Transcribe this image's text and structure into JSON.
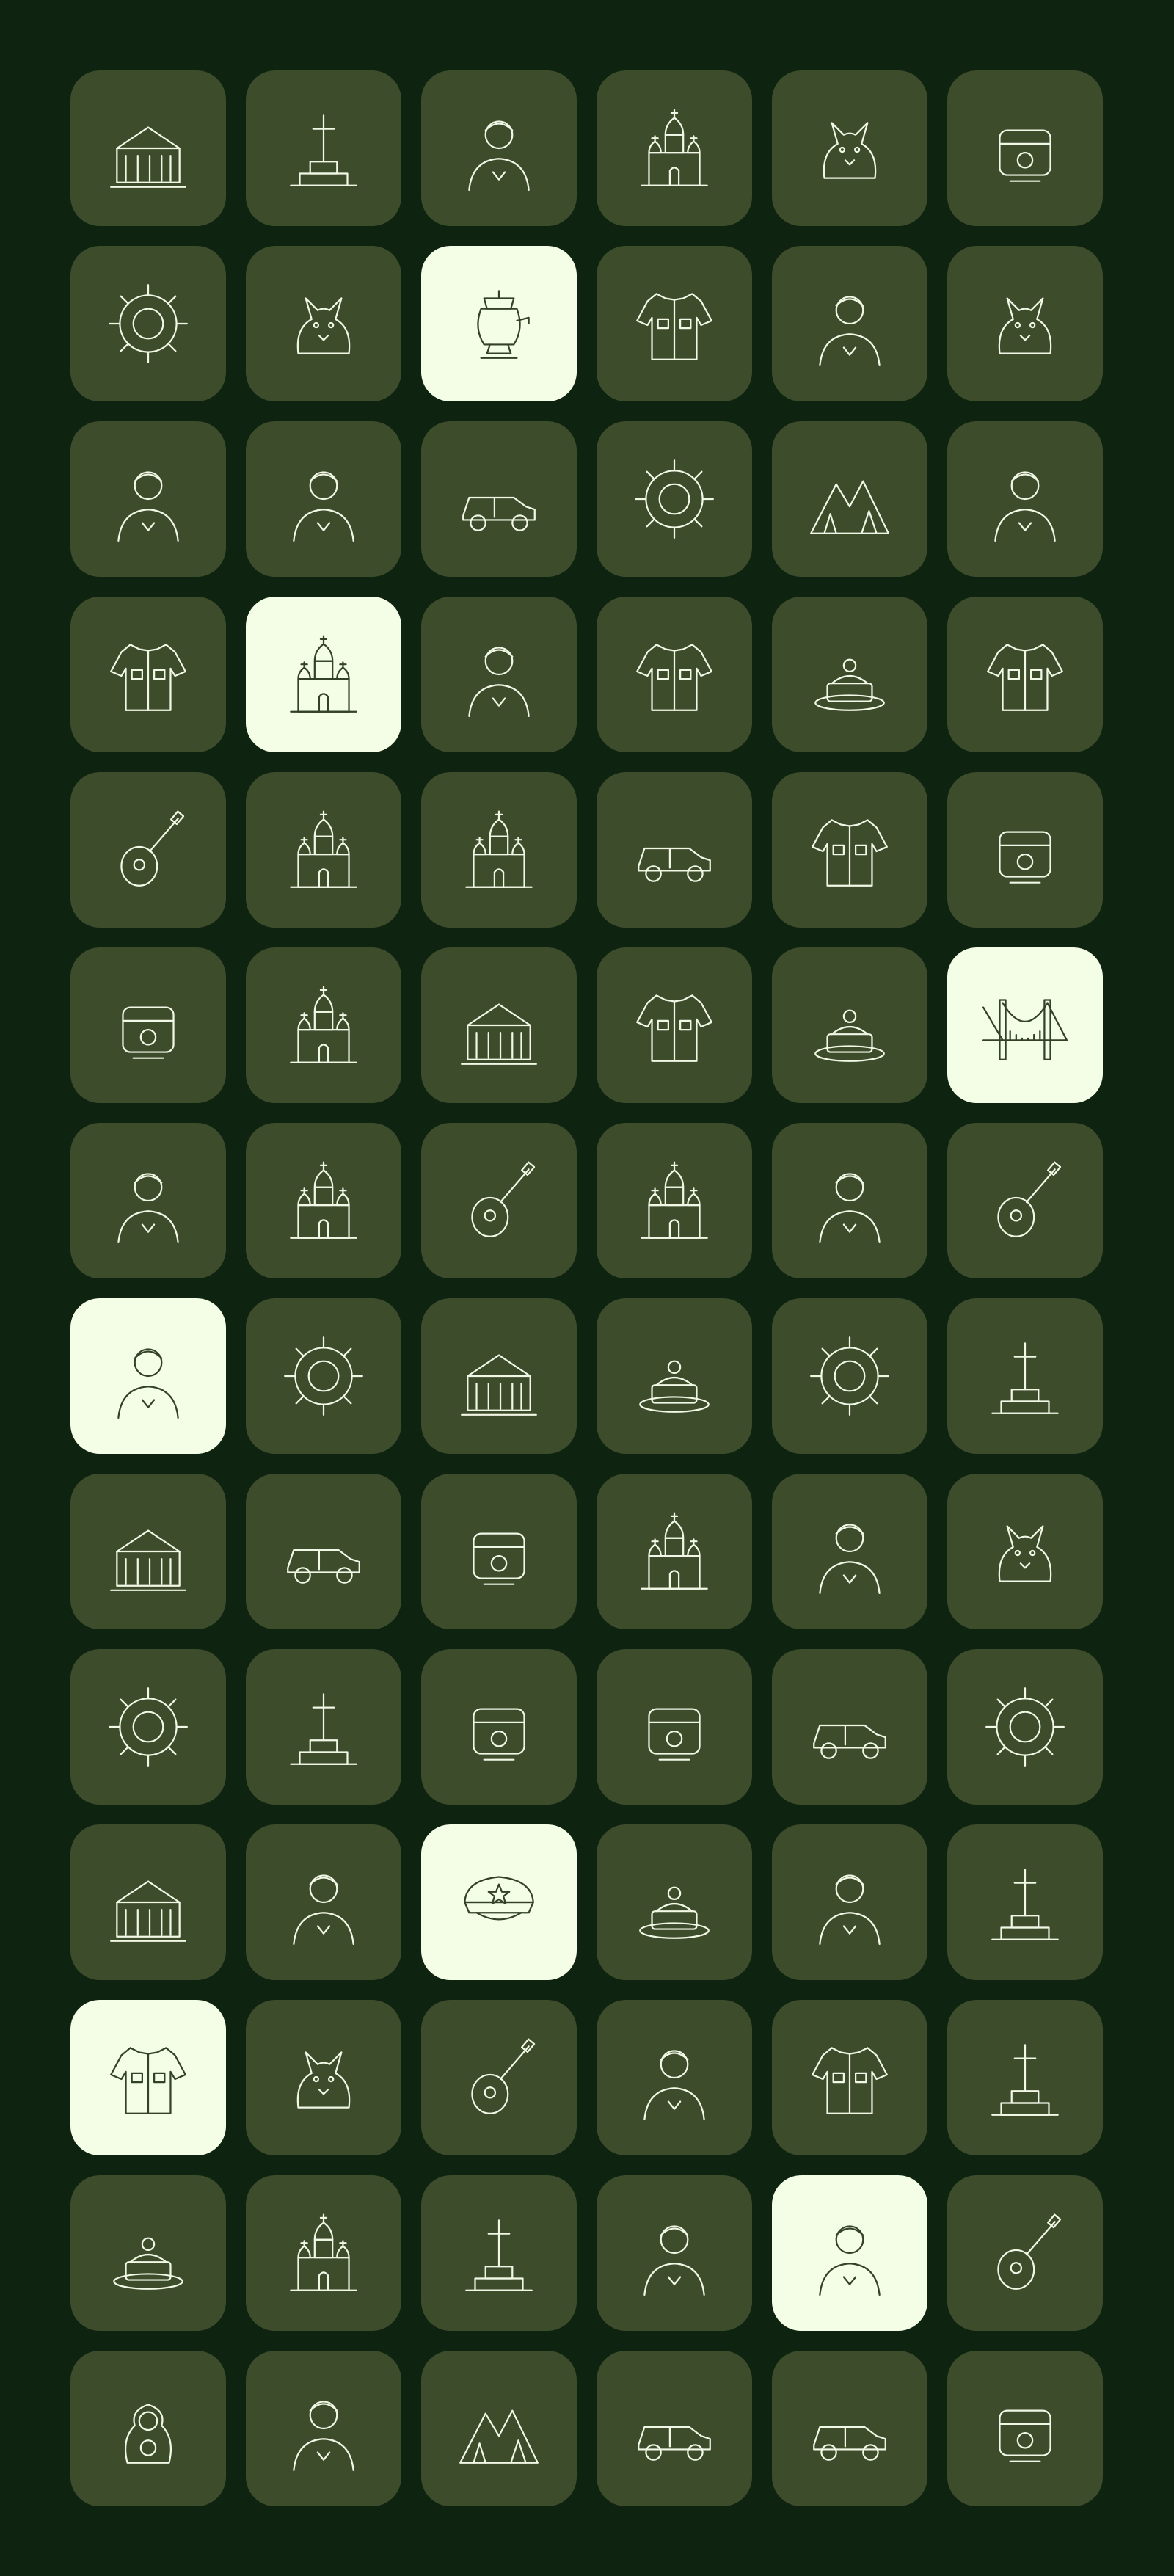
{
  "palette": {
    "background": "#0f2311",
    "tile": "#3d4c2b",
    "tile_selected": "#f4fde6",
    "icon_stroke": "#f2f8e6",
    "icon_stroke_selected": "#33402a"
  },
  "icons": [
    {
      "name": "mausoleum-icon",
      "selected": false
    },
    {
      "name": "crystals-monument-icon",
      "selected": false
    },
    {
      "name": "hockey-player-icon",
      "selected": false
    },
    {
      "name": "kremlin-cathedral-icon",
      "selected": false
    },
    {
      "name": "deer-head-icon",
      "selected": false
    },
    {
      "name": "pickles-jar-icon",
      "selected": false
    },
    {
      "name": "hammer-sickle-shield-icon",
      "selected": false
    },
    {
      "name": "horse-rider-icon",
      "selected": false
    },
    {
      "name": "samovar-icon",
      "selected": true
    },
    {
      "name": "folk-dress-icon",
      "selected": false
    },
    {
      "name": "bearded-man-icon",
      "selected": false
    },
    {
      "name": "cat-icon",
      "selected": false
    },
    {
      "name": "ballerina-icon",
      "selected": false
    },
    {
      "name": "soldier-portrait-icon",
      "selected": false
    },
    {
      "name": "steam-locomotive-icon",
      "selected": false
    },
    {
      "name": "sun-ornament-icon",
      "selected": false
    },
    {
      "name": "mountains-forest-icon",
      "selected": false
    },
    {
      "name": "orthodox-priest-icon",
      "selected": false
    },
    {
      "name": "jacket-icon",
      "selected": false
    },
    {
      "name": "church-icon",
      "selected": true
    },
    {
      "name": "woman-fur-coat-icon",
      "selected": false
    },
    {
      "name": "military-shirt-icon",
      "selected": false
    },
    {
      "name": "tea-set-icon",
      "selected": false
    },
    {
      "name": "folk-skirt-icon",
      "selected": false
    },
    {
      "name": "bagpipes-icon",
      "selected": false
    },
    {
      "name": "postage-stamp-icon",
      "selected": false
    },
    {
      "name": "palace-icon",
      "selected": false
    },
    {
      "name": "viking-ship-icon",
      "selected": false
    },
    {
      "name": "shawl-icon",
      "selected": false
    },
    {
      "name": "chess-board-icon",
      "selected": false
    },
    {
      "name": "chalice-icon",
      "selected": false
    },
    {
      "name": "tourists-kremlin-icon",
      "selected": false
    },
    {
      "name": "theatre-building-icon",
      "selected": false
    },
    {
      "name": "embroidered-shirt-icon",
      "selected": false
    },
    {
      "name": "layered-cake-icon",
      "selected": false
    },
    {
      "name": "bridge-icon",
      "selected": true
    },
    {
      "name": "man-cap-icon",
      "selected": false
    },
    {
      "name": "onion-dome-cathedral-icon",
      "selected": false
    },
    {
      "name": "maracas-icon",
      "selected": false
    },
    {
      "name": "monastery-icon",
      "selected": false
    },
    {
      "name": "cosmonaut-icon",
      "selected": false
    },
    {
      "name": "saxophone-icon",
      "selected": false
    },
    {
      "name": "children-reading-icon",
      "selected": true
    },
    {
      "name": "star-medal-icon",
      "selected": false
    },
    {
      "name": "triumphal-arch-icon",
      "selected": false
    },
    {
      "name": "honey-pancakes-icon",
      "selected": false
    },
    {
      "name": "flower-brush-icon",
      "selected": false
    },
    {
      "name": "drawbridge-icon",
      "selected": false
    },
    {
      "name": "government-building-icon",
      "selected": false
    },
    {
      "name": "vintage-car-icon",
      "selected": false
    },
    {
      "name": "street-cart-icon",
      "selected": false
    },
    {
      "name": "basilica-icon",
      "selected": false
    },
    {
      "name": "nun-icon",
      "selected": false
    },
    {
      "name": "rooster-icon",
      "selected": false
    },
    {
      "name": "folk-flower-ornament-icon",
      "selected": false
    },
    {
      "name": "spasskaya-tower-icon",
      "selected": false
    },
    {
      "name": "beer-tap-mug-icon",
      "selected": false
    },
    {
      "name": "stove-icon",
      "selected": false
    },
    {
      "name": "cannon-icon",
      "selected": false
    },
    {
      "name": "spinning-wheel-icon",
      "selected": false
    },
    {
      "name": "university-tower-icon",
      "selected": false
    },
    {
      "name": "woman-kokoshnik-icon",
      "selected": false
    },
    {
      "name": "peaked-cap-icon",
      "selected": true
    },
    {
      "name": "bagels-icon",
      "selected": false
    },
    {
      "name": "man-hat-icon",
      "selected": false
    },
    {
      "name": "statue-icon",
      "selected": false
    },
    {
      "name": "military-coat-icon",
      "selected": true
    },
    {
      "name": "fox-snow-icon",
      "selected": false
    },
    {
      "name": "balalaika-icon",
      "selected": false
    },
    {
      "name": "guitar-player-icon",
      "selected": false
    },
    {
      "name": "patterned-scarf-icon",
      "selected": false
    },
    {
      "name": "cross-monument-icon",
      "selected": false
    },
    {
      "name": "festive-table-icon",
      "selected": false
    },
    {
      "name": "castle-icon",
      "selected": false
    },
    {
      "name": "orthodox-cross-icon",
      "selected": false
    },
    {
      "name": "old-man-beard-icon",
      "selected": false
    },
    {
      "name": "woman-tea-cup-icon",
      "selected": true
    },
    {
      "name": "flute-icon",
      "selected": false
    },
    {
      "name": "matryoshka-icon",
      "selected": false
    },
    {
      "name": "man-hood-icon",
      "selected": false
    },
    {
      "name": "bonfire-icon",
      "selected": false
    },
    {
      "name": "fighter-jet-icon",
      "selected": false
    },
    {
      "name": "submarine-icon",
      "selected": false
    },
    {
      "name": "imperial-crown-icon",
      "selected": false
    }
  ]
}
